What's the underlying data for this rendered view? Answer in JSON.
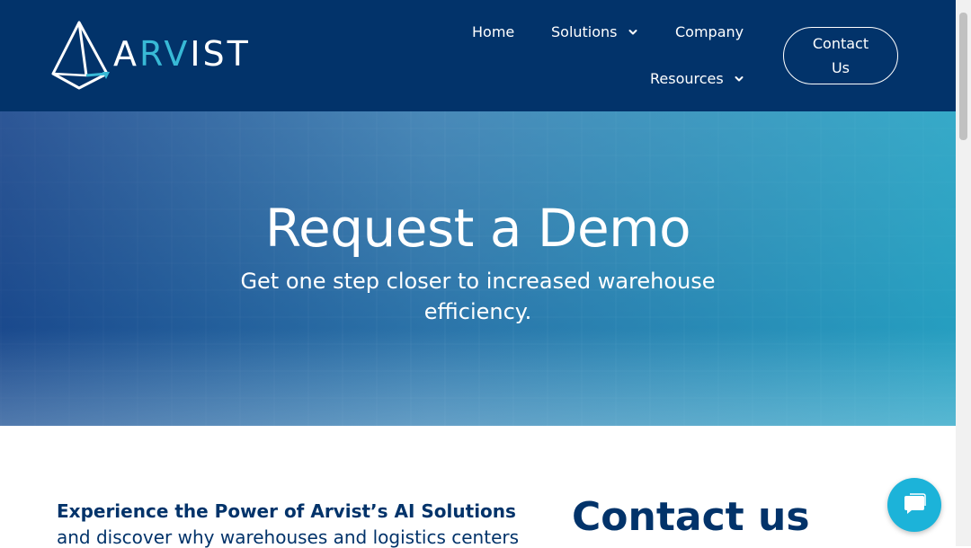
{
  "brand": {
    "name_prefix": "A",
    "name_accent": "RV",
    "name_suffix": "IST",
    "colors": {
      "navy": "#02336a",
      "accent": "#38b9d6",
      "chat": "#1cb3d9"
    }
  },
  "nav": {
    "home": "Home",
    "solutions": "Solutions",
    "company": "Company",
    "resources": "Resources",
    "contact_button": "Contact Us"
  },
  "hero": {
    "title": "Request a Demo",
    "subtitle_line1": "Get one step closer to increased warehouse",
    "subtitle_line2": "efficiency."
  },
  "content": {
    "intro_heading": "Experience the Power of Arvist’s AI Solutions",
    "intro_body": "and discover why warehouses and logistics centers",
    "contact_heading": "Contact us"
  },
  "icons": {
    "logo": "diamond-prism-icon",
    "dropdown": "chevron-down-icon",
    "chat": "chat-icon"
  }
}
